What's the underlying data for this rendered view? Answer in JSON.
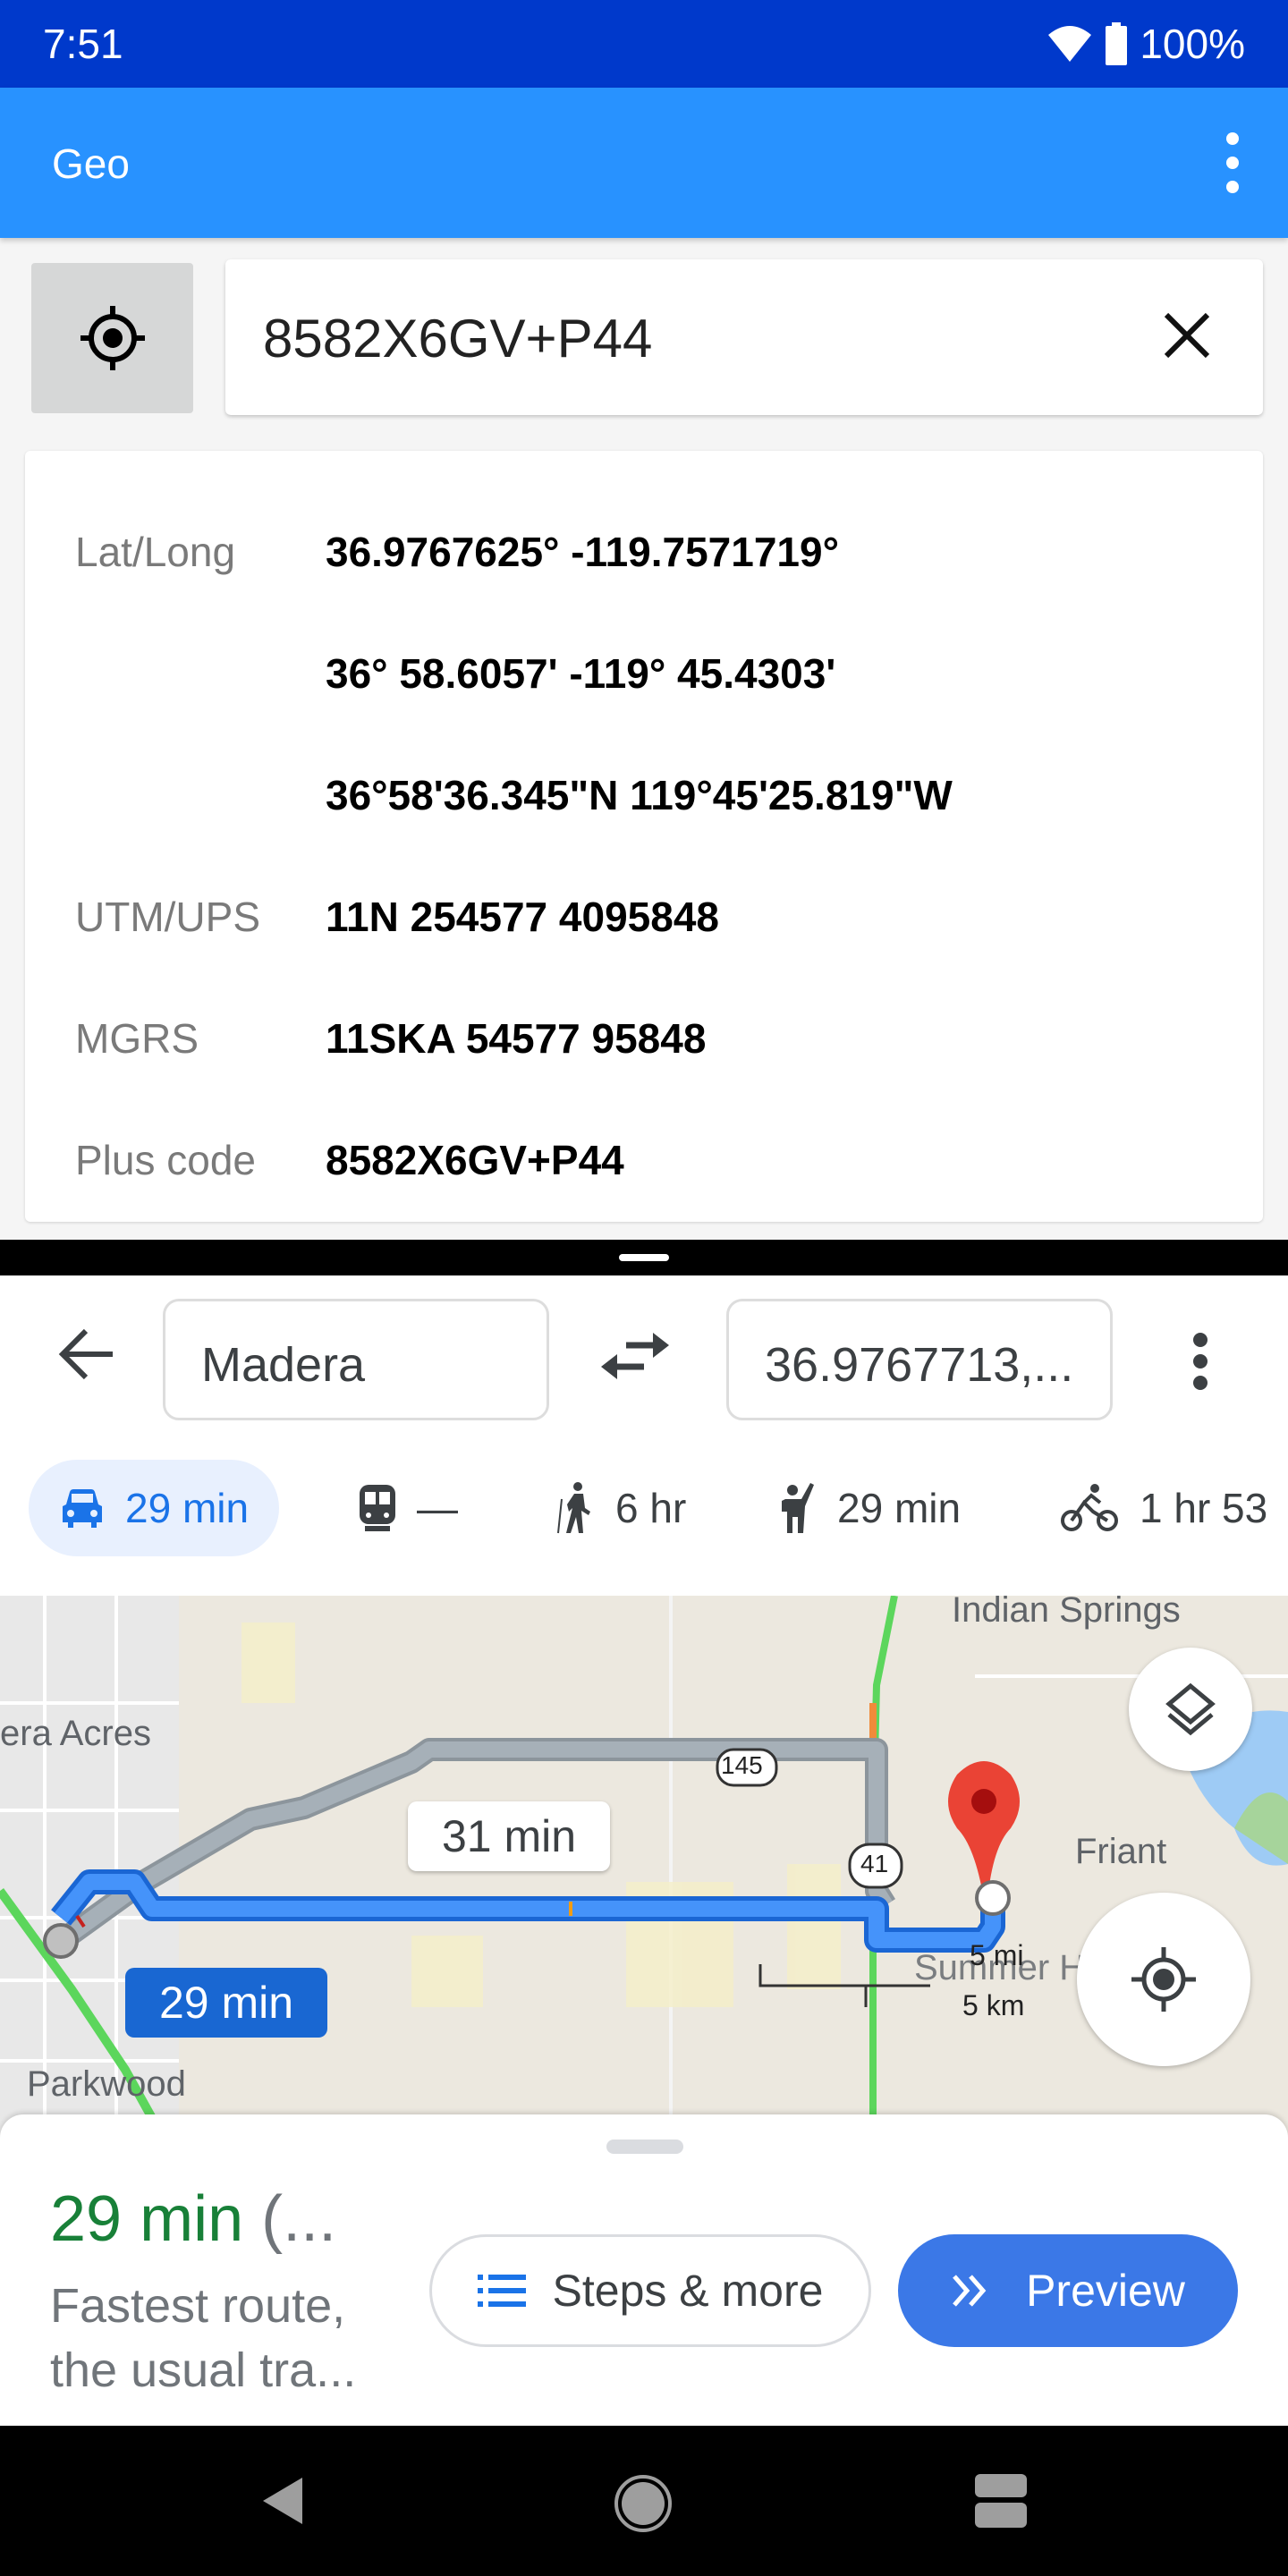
{
  "status_bar": {
    "time": "7:51",
    "battery": "100%",
    "wifi_icon": "wifi-icon",
    "battery_icon": "battery-icon"
  },
  "app_bar": {
    "title": "Geo",
    "menu_icon": "more-vert-icon"
  },
  "search": {
    "value": "8582X6GV+P44",
    "locate_icon": "my-location-icon",
    "clear_icon": "close-icon"
  },
  "coordinates": {
    "rows": [
      {
        "label": "Lat/Long",
        "value": "36.9767625° -119.7571719°"
      },
      {
        "label": "",
        "value": "36° 58.6057' -119° 45.4303'"
      },
      {
        "label": "",
        "value": "36°58'36.345\"N 119°45'25.819\"W"
      },
      {
        "label": "UTM/UPS",
        "value": "11N 254577 4095848"
      },
      {
        "label": "MGRS",
        "value": "11SKA 54577 95848"
      },
      {
        "label": "Plus code",
        "value": "8582X6GV+P44"
      }
    ]
  },
  "directions": {
    "origin": "Madera",
    "destination": "36.9767713,...",
    "modes": [
      {
        "icon": "car-icon",
        "label": "29 min",
        "active": true
      },
      {
        "icon": "train-icon",
        "label": "—",
        "active": false
      },
      {
        "icon": "walk-icon",
        "label": "6 hr",
        "active": false
      },
      {
        "icon": "ride-hail-icon",
        "label": "29 min",
        "active": false
      },
      {
        "icon": "bike-icon",
        "label": "1 hr 53",
        "active": false
      }
    ]
  },
  "map": {
    "places": [
      "Indian Springs",
      "era Acres",
      "Friant",
      "Parkwood",
      "Summer H"
    ],
    "route_labels": {
      "primary": "29 min",
      "alternate": "31 min"
    },
    "highway_shields": [
      "145",
      "41"
    ],
    "scale": {
      "miles": "5 mi",
      "km": "5 km"
    },
    "colors": {
      "primary_route": "#4285f4",
      "alternate_route": "#a6b0b8",
      "pin": "#ea4335",
      "traffic_green": "#5cd65c"
    }
  },
  "sheet": {
    "time": "29 min",
    "time_suffix": " (...",
    "desc_line1": "Fastest route,",
    "desc_line2": "the usual tra...",
    "steps_label": "Steps & more",
    "preview_label": "Preview"
  },
  "colors": {
    "status_bar": "#0039cb",
    "app_bar": "#2892ff",
    "accent": "#1a73e8",
    "time_green": "#188038"
  }
}
